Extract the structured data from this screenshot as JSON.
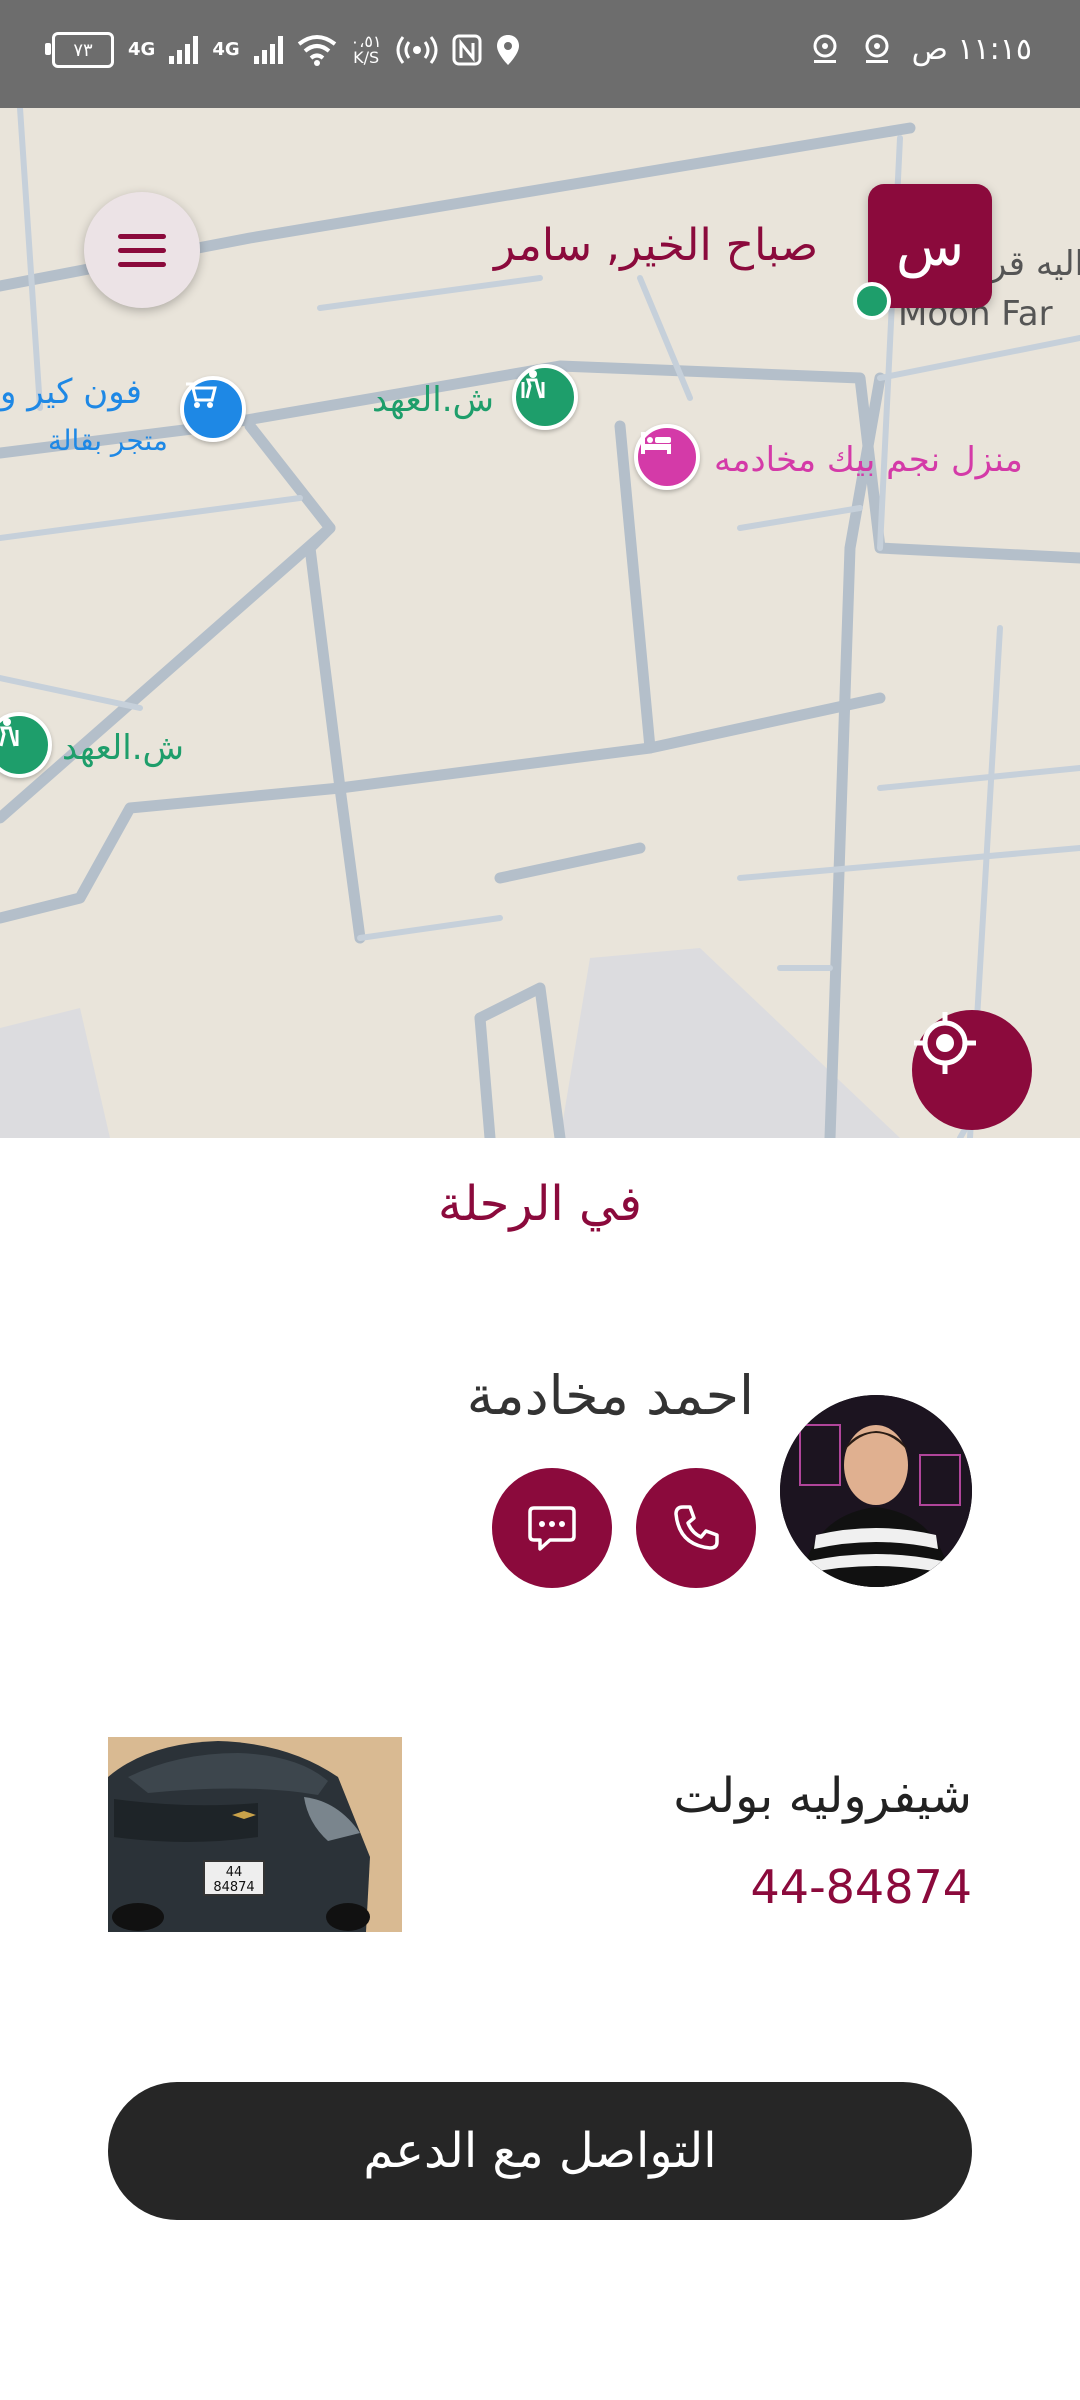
{
  "status_bar": {
    "battery": "٧٣",
    "network_1": "4G",
    "network_2": "4G",
    "speed_value": "٠،٥١",
    "speed_unit": "K/S",
    "time": "١١:١٥ ص"
  },
  "map": {
    "greeting": "صباح الخير, سامر",
    "user_initial": "س",
    "poi": [
      {
        "label": "ش.العهد",
        "icon": "hiking-icon",
        "color": "#1e9e6b"
      },
      {
        "label": "منزل نجم بيك مخادمه",
        "icon": "bed-icon",
        "color": "#d43aa8"
      },
      {
        "label": "فون كير و",
        "sublabel": "متجر بقالة",
        "icon": "cart-icon",
        "color": "#1e88e5"
      },
      {
        "label": "ش.العهد",
        "icon": "hiking-icon",
        "color": "#1e9e6b"
      }
    ],
    "partial_label_1": "اليه قر",
    "partial_label_2": "Moon Far"
  },
  "trip": {
    "status": "في الرحلة"
  },
  "driver": {
    "name": "احمد مخادمة"
  },
  "car": {
    "model": "شيفروليه بولت",
    "plate": "44-84874",
    "photo_plate_line1": "44",
    "photo_plate_line2": "84874"
  },
  "support": {
    "label": "التواصل مع الدعم"
  },
  "colors": {
    "brand": "#8b0a3c",
    "dark_button": "#262626"
  }
}
